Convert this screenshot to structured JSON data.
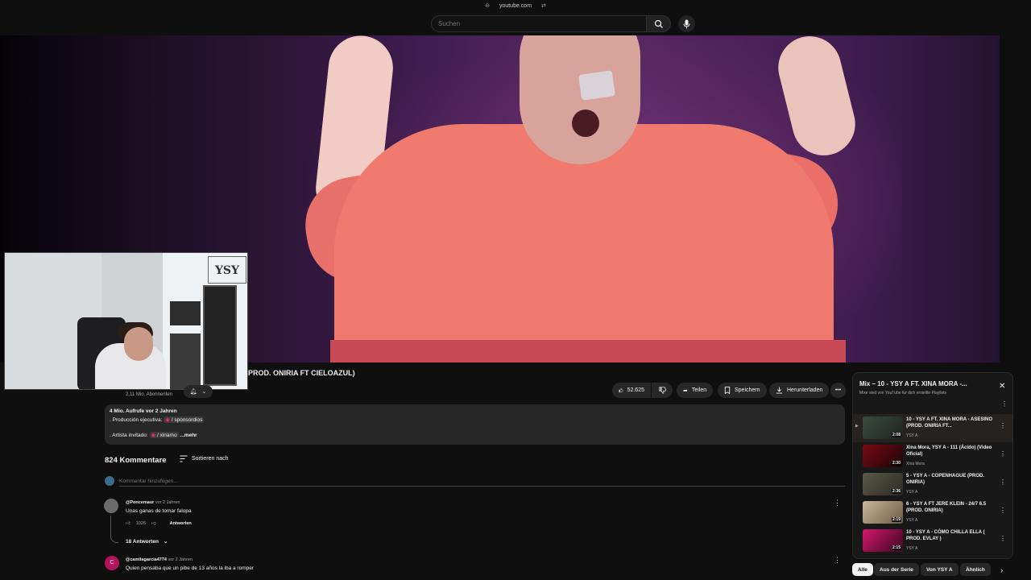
{
  "browser": {
    "url": "youtube.com"
  },
  "header": {
    "search_placeholder": "Suchen"
  },
  "video": {
    "title_visible": "PROD. ONIRIA FT CIELOAZUL)",
    "subscribers": "2,11 Mio. Abonnenten",
    "likes": "52.625",
    "share_label": "Teilen",
    "save_label": "Speichern",
    "download_label": "Herunterladen"
  },
  "webcam": {
    "logo_text": "YSY"
  },
  "description": {
    "views_date": "4 Mio. Aufrufe  vor 2 Jahren",
    "line1_prefix": ". Producción ejecutiva:",
    "line1_chip": "/ sponsordios",
    "line2_prefix": ". Artista invitado:",
    "line2_chip": "/ xinamo",
    "more_label": "...mehr"
  },
  "comments": {
    "count_label": "824 Kommentare",
    "sort_label": "Sortieren nach",
    "add_placeholder": "Kommentar hinzufügen...",
    "reply_label": "Antworten",
    "items": [
      {
        "author": "@Poncemaur",
        "time": "vor 2 Jahren",
        "text": "Unas ganas de tomar falopa",
        "likes": "1026",
        "replies": "18 Antworten"
      },
      {
        "author": "@camilagarcia4774",
        "time": "vor 2 Jahren",
        "text": "Quien pensaba que un pibe de 13 años la iba a romper"
      }
    ]
  },
  "playlist": {
    "title": "Mix – 10 - YSY A FT. XINA MORA -...",
    "subtitle": "Mixe sind von YouTube für dich erstellte Playlists",
    "items": [
      {
        "title": "10 - YSY A FT. XINA MORA - ASESINO (PROD. ONIRIA FT...",
        "channel": "YSY A",
        "duration": "2:08",
        "active": true
      },
      {
        "title": "Xina Mora, YSY A - 111 (Ácido) (Video Oficial)",
        "channel": "Xina Mora",
        "duration": "2:30"
      },
      {
        "title": "5 - YSY A - COPENHAGUE (PROD. ONIRIA)",
        "channel": "YSY A",
        "duration": "2:36"
      },
      {
        "title": "6 - YSY A FT JERE KLEIN - 24/7 6.5 (PROD. ONIRIA)",
        "channel": "YSY A",
        "duration": "2:19"
      },
      {
        "title": "10 - YSY A - CÓMO CHILLA ELLA ( PROD. EVLAY )",
        "channel": "YSY A",
        "duration": "2:15"
      }
    ]
  },
  "filter_chips": [
    "Alle",
    "Aus der Serie",
    "Von YSY A",
    "Ähnlich"
  ],
  "colors": {
    "background": "#0f0f0f",
    "surface": "#272727",
    "text": "#f1f1f1",
    "muted": "#aaaaaa"
  }
}
